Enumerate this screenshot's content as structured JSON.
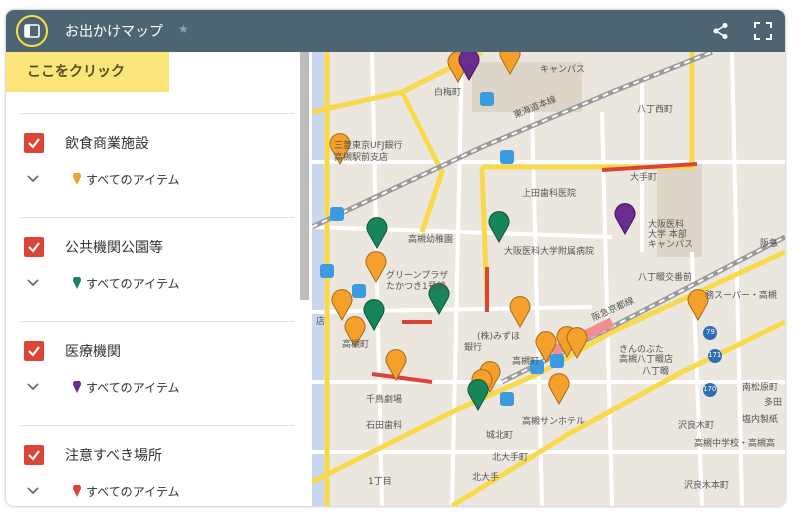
{
  "header": {
    "title": "お出かけマップ",
    "star_icon": "star-icon",
    "share_icon": "share-icon",
    "fullscreen_icon": "fullscreen-icon",
    "panel_icon": "panel-toggle-icon",
    "bg_color": "#4d6572",
    "highlight_color": "#f5e04a"
  },
  "sidebar": {
    "callout": "ここをクリック",
    "layers": [
      {
        "name": "飲食商業施設",
        "sub": "すべてのアイテム",
        "pin_color": "#f4a02b"
      },
      {
        "name": "公共機関公園等",
        "sub": "すべてのアイテム",
        "pin_color": "#16865a"
      },
      {
        "name": "医療機関",
        "sub": "すべてのアイテム",
        "pin_color": "#6a2c91"
      },
      {
        "name": "注意すべき場所",
        "sub": "すべてのアイテム",
        "pin_color": "#db4437"
      }
    ],
    "checkbox_color": "#db4437"
  },
  "map": {
    "labels": {
      "l1": "キャンパス",
      "l2": "白梅町",
      "l3": "八丁西町",
      "l4": "東海道本線",
      "l5": "三菱東京UFJ銀行",
      "l6": "高槻駅前支店",
      "l7": "大手町",
      "l8": "上田歯科医院",
      "l9": "大阪医科",
      "l10": "大学 本部",
      "l11": "キャンパス",
      "l12": "大阪医科大学附属病院",
      "l13": "阪急",
      "l14": "高槻幼稚園",
      "l15": "グリーンプラザ",
      "l16": "たかつき1号館",
      "l17": "八丁畷交番前",
      "l18": "務スーパー・高槻",
      "l19": "阪急京都線",
      "l20": "(株)みずほ",
      "l21": "銀行",
      "l22": "高槻町",
      "l23": "きんのぶた",
      "l24": "高槻八丁畷店",
      "l25": "八丁畷",
      "l26": "171",
      "l27": "79",
      "l28": "170",
      "l29": "南松原町",
      "l30": "多田",
      "l31": "千鳥劇場",
      "l32": "石田歯科",
      "l33": "高槻サンホテル",
      "l34": "城北町",
      "l35": "北大手町",
      "l36": "北大手",
      "l37": "1丁目",
      "l38": "沢良木町",
      "l39": "塩内製紙",
      "l40": "高槻中学校・高槻高",
      "l41": "沢良木本町",
      "l42": "高槻町",
      "l43": "店"
    }
  }
}
